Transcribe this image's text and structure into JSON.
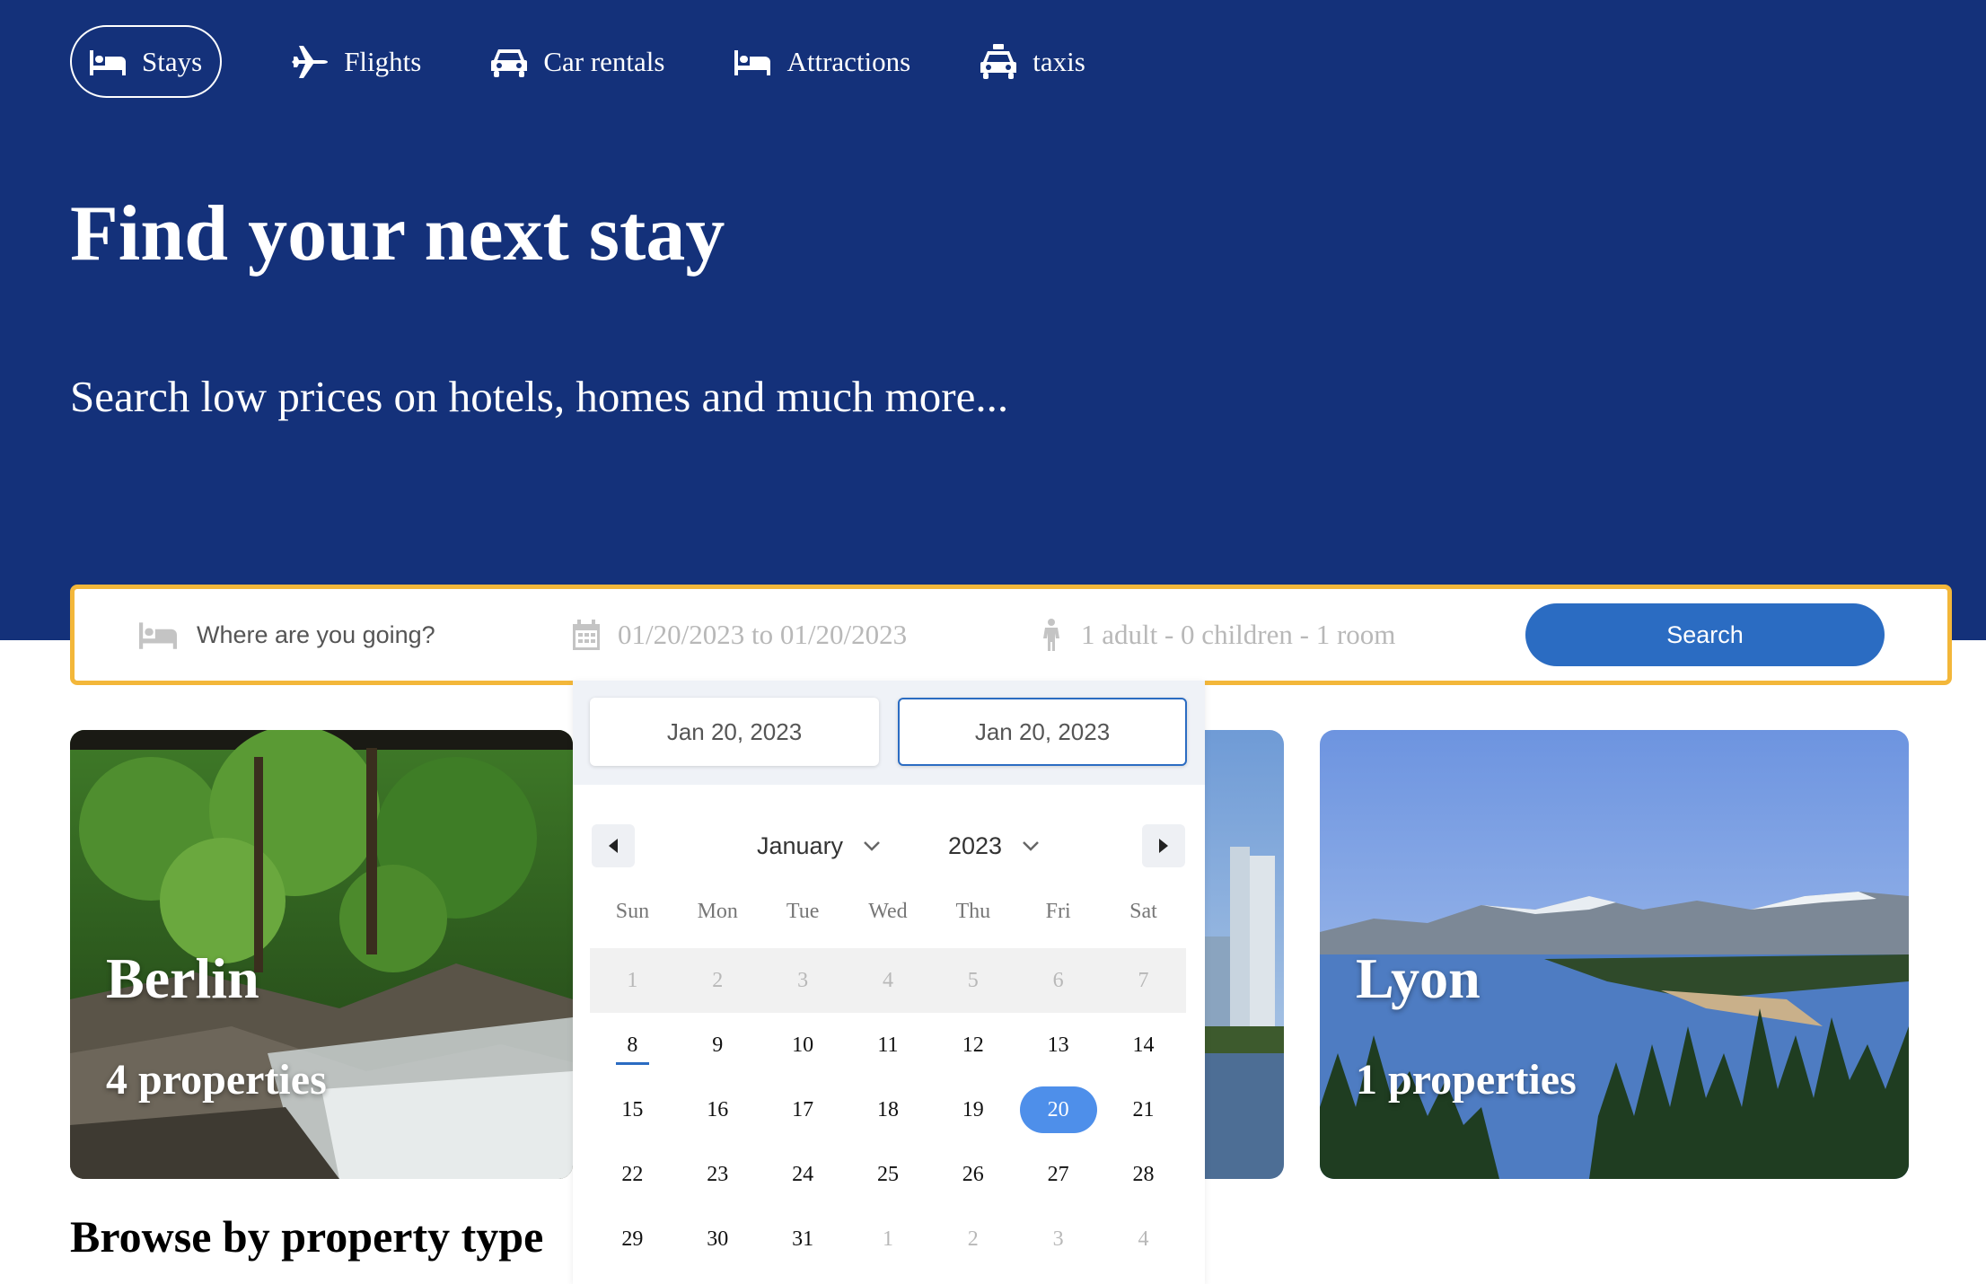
{
  "nav": {
    "items": [
      {
        "label": "Stays",
        "icon": "bed-icon",
        "active": true
      },
      {
        "label": "Flights",
        "icon": "plane-icon",
        "active": false
      },
      {
        "label": "Car rentals",
        "icon": "car-icon",
        "active": false
      },
      {
        "label": "Attractions",
        "icon": "bed-icon",
        "active": false
      },
      {
        "label": "taxis",
        "icon": "taxi-icon",
        "active": false
      }
    ]
  },
  "hero": {
    "title": "Find your next stay",
    "subtitle": "Search low prices on hotels, homes and much more..."
  },
  "search": {
    "destination_placeholder": "Where are you going?",
    "dates": "01/20/2023 to 01/20/2023",
    "guests": "1 adult - 0 children - 1 room",
    "button_label": "Search"
  },
  "calendar": {
    "start_date": "Jan 20, 2023",
    "end_date": "Jan 20, 2023",
    "month": "January",
    "year": "2023",
    "weekdays": [
      "Sun",
      "Mon",
      "Tue",
      "Wed",
      "Thu",
      "Fri",
      "Sat"
    ],
    "weeks": [
      [
        "1",
        "2",
        "3",
        "4",
        "5",
        "6",
        "7"
      ],
      [
        "8",
        "9",
        "10",
        "11",
        "12",
        "13",
        "14"
      ],
      [
        "15",
        "16",
        "17",
        "18",
        "19",
        "20",
        "21"
      ],
      [
        "22",
        "23",
        "24",
        "25",
        "26",
        "27",
        "28"
      ],
      [
        "29",
        "30",
        "31",
        "1",
        "2",
        "3",
        "4"
      ]
    ],
    "today": "8",
    "selected": "20"
  },
  "cities": [
    {
      "name": "Berlin",
      "count": "4 properties"
    },
    {
      "name": "Lyon",
      "count": "1 properties"
    }
  ],
  "browse_title": "Browse by property type",
  "colors": {
    "hero_bg": "#14317a",
    "accent": "#2b6cc2",
    "search_border": "#f3b73a",
    "selected_day": "#4e8fea"
  }
}
